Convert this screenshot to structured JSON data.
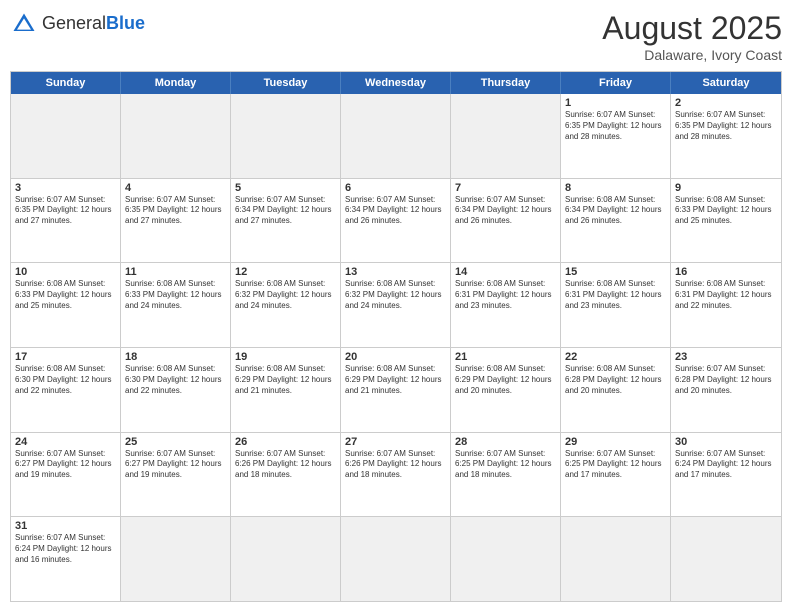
{
  "header": {
    "logo_general": "General",
    "logo_blue": "Blue",
    "month_year": "August 2025",
    "location": "Dalaware, Ivory Coast"
  },
  "day_headers": [
    "Sunday",
    "Monday",
    "Tuesday",
    "Wednesday",
    "Thursday",
    "Friday",
    "Saturday"
  ],
  "weeks": [
    [
      {
        "day": "",
        "empty": true
      },
      {
        "day": "",
        "empty": true
      },
      {
        "day": "",
        "empty": true
      },
      {
        "day": "",
        "empty": true
      },
      {
        "day": "",
        "empty": true
      },
      {
        "day": "1",
        "info": "Sunrise: 6:07 AM\nSunset: 6:35 PM\nDaylight: 12 hours\nand 28 minutes."
      },
      {
        "day": "2",
        "info": "Sunrise: 6:07 AM\nSunset: 6:35 PM\nDaylight: 12 hours\nand 28 minutes."
      }
    ],
    [
      {
        "day": "3",
        "info": "Sunrise: 6:07 AM\nSunset: 6:35 PM\nDaylight: 12 hours\nand 27 minutes."
      },
      {
        "day": "4",
        "info": "Sunrise: 6:07 AM\nSunset: 6:35 PM\nDaylight: 12 hours\nand 27 minutes."
      },
      {
        "day": "5",
        "info": "Sunrise: 6:07 AM\nSunset: 6:34 PM\nDaylight: 12 hours\nand 27 minutes."
      },
      {
        "day": "6",
        "info": "Sunrise: 6:07 AM\nSunset: 6:34 PM\nDaylight: 12 hours\nand 26 minutes."
      },
      {
        "day": "7",
        "info": "Sunrise: 6:07 AM\nSunset: 6:34 PM\nDaylight: 12 hours\nand 26 minutes."
      },
      {
        "day": "8",
        "info": "Sunrise: 6:08 AM\nSunset: 6:34 PM\nDaylight: 12 hours\nand 26 minutes."
      },
      {
        "day": "9",
        "info": "Sunrise: 6:08 AM\nSunset: 6:33 PM\nDaylight: 12 hours\nand 25 minutes."
      }
    ],
    [
      {
        "day": "10",
        "info": "Sunrise: 6:08 AM\nSunset: 6:33 PM\nDaylight: 12 hours\nand 25 minutes."
      },
      {
        "day": "11",
        "info": "Sunrise: 6:08 AM\nSunset: 6:33 PM\nDaylight: 12 hours\nand 24 minutes."
      },
      {
        "day": "12",
        "info": "Sunrise: 6:08 AM\nSunset: 6:32 PM\nDaylight: 12 hours\nand 24 minutes."
      },
      {
        "day": "13",
        "info": "Sunrise: 6:08 AM\nSunset: 6:32 PM\nDaylight: 12 hours\nand 24 minutes."
      },
      {
        "day": "14",
        "info": "Sunrise: 6:08 AM\nSunset: 6:31 PM\nDaylight: 12 hours\nand 23 minutes."
      },
      {
        "day": "15",
        "info": "Sunrise: 6:08 AM\nSunset: 6:31 PM\nDaylight: 12 hours\nand 23 minutes."
      },
      {
        "day": "16",
        "info": "Sunrise: 6:08 AM\nSunset: 6:31 PM\nDaylight: 12 hours\nand 22 minutes."
      }
    ],
    [
      {
        "day": "17",
        "info": "Sunrise: 6:08 AM\nSunset: 6:30 PM\nDaylight: 12 hours\nand 22 minutes."
      },
      {
        "day": "18",
        "info": "Sunrise: 6:08 AM\nSunset: 6:30 PM\nDaylight: 12 hours\nand 22 minutes."
      },
      {
        "day": "19",
        "info": "Sunrise: 6:08 AM\nSunset: 6:29 PM\nDaylight: 12 hours\nand 21 minutes."
      },
      {
        "day": "20",
        "info": "Sunrise: 6:08 AM\nSunset: 6:29 PM\nDaylight: 12 hours\nand 21 minutes."
      },
      {
        "day": "21",
        "info": "Sunrise: 6:08 AM\nSunset: 6:29 PM\nDaylight: 12 hours\nand 20 minutes."
      },
      {
        "day": "22",
        "info": "Sunrise: 6:08 AM\nSunset: 6:28 PM\nDaylight: 12 hours\nand 20 minutes."
      },
      {
        "day": "23",
        "info": "Sunrise: 6:07 AM\nSunset: 6:28 PM\nDaylight: 12 hours\nand 20 minutes."
      }
    ],
    [
      {
        "day": "24",
        "info": "Sunrise: 6:07 AM\nSunset: 6:27 PM\nDaylight: 12 hours\nand 19 minutes."
      },
      {
        "day": "25",
        "info": "Sunrise: 6:07 AM\nSunset: 6:27 PM\nDaylight: 12 hours\nand 19 minutes."
      },
      {
        "day": "26",
        "info": "Sunrise: 6:07 AM\nSunset: 6:26 PM\nDaylight: 12 hours\nand 18 minutes."
      },
      {
        "day": "27",
        "info": "Sunrise: 6:07 AM\nSunset: 6:26 PM\nDaylight: 12 hours\nand 18 minutes."
      },
      {
        "day": "28",
        "info": "Sunrise: 6:07 AM\nSunset: 6:25 PM\nDaylight: 12 hours\nand 18 minutes."
      },
      {
        "day": "29",
        "info": "Sunrise: 6:07 AM\nSunset: 6:25 PM\nDaylight: 12 hours\nand 17 minutes."
      },
      {
        "day": "30",
        "info": "Sunrise: 6:07 AM\nSunset: 6:24 PM\nDaylight: 12 hours\nand 17 minutes."
      }
    ],
    [
      {
        "day": "31",
        "info": "Sunrise: 6:07 AM\nSunset: 6:24 PM\nDaylight: 12 hours\nand 16 minutes."
      },
      {
        "day": "",
        "empty": true
      },
      {
        "day": "",
        "empty": true
      },
      {
        "day": "",
        "empty": true
      },
      {
        "day": "",
        "empty": true
      },
      {
        "day": "",
        "empty": true
      },
      {
        "day": "",
        "empty": true
      }
    ]
  ]
}
